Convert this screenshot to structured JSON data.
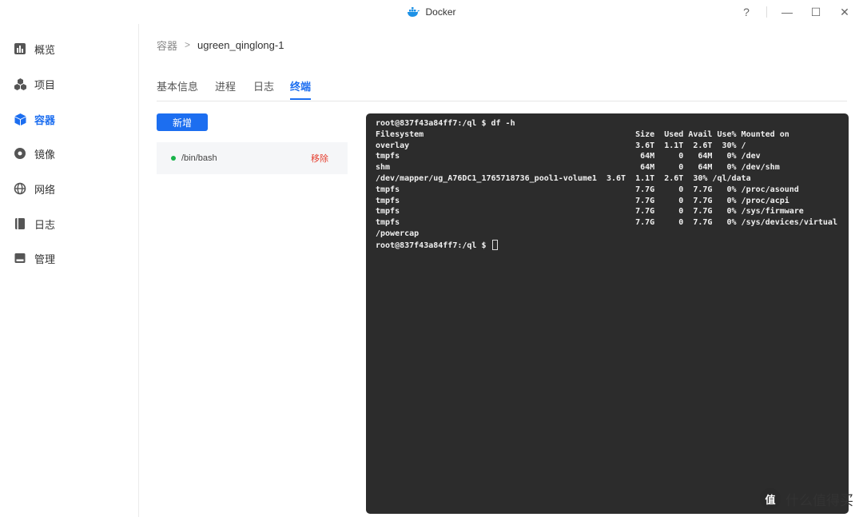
{
  "window": {
    "title": "Docker",
    "help": "?",
    "minimize": "—",
    "maximize": "☐",
    "close": "✕"
  },
  "sidebar": {
    "items": [
      {
        "label": "概览",
        "icon": "chart-icon",
        "active": false
      },
      {
        "label": "项目",
        "icon": "cubes-icon",
        "active": false
      },
      {
        "label": "容器",
        "icon": "cube-icon",
        "active": true
      },
      {
        "label": "镜像",
        "icon": "disc-icon",
        "active": false
      },
      {
        "label": "网络",
        "icon": "globe-icon",
        "active": false
      },
      {
        "label": "日志",
        "icon": "book-icon",
        "active": false
      },
      {
        "label": "管理",
        "icon": "manage-icon",
        "active": false
      }
    ]
  },
  "breadcrumb": {
    "root": "容器",
    "separator": ">",
    "current": "ugreen_qinglong-1"
  },
  "tabs": [
    {
      "label": "基本信息",
      "active": false
    },
    {
      "label": "进程",
      "active": false
    },
    {
      "label": "日志",
      "active": false
    },
    {
      "label": "终端",
      "active": true
    }
  ],
  "terminal_panel": {
    "add_label": "新增",
    "sessions": [
      {
        "name": "/bin/bash",
        "status": "running",
        "remove_label": "移除"
      }
    ]
  },
  "terminal": {
    "lines": [
      "root@837f43a84ff7:/ql $ df -h",
      "Filesystem                                            Size  Used Avail Use% Mounted on",
      "overlay                                               3.6T  1.1T  2.6T  30% /",
      "tmpfs                                                  64M     0   64M   0% /dev",
      "shm                                                    64M     0   64M   0% /dev/shm",
      "/dev/mapper/ug_A76DC1_1765718736_pool1-volume1  3.6T  1.1T  2.6T  30% /ql/data",
      "tmpfs                                                 7.7G     0  7.7G   0% /proc/asound",
      "tmpfs                                                 7.7G     0  7.7G   0% /proc/acpi",
      "tmpfs                                                 7.7G     0  7.7G   0% /sys/firmware",
      "tmpfs                                                 7.7G     0  7.7G   0% /sys/devices/virtual",
      "/powercap"
    ],
    "prompt": "root@837f43a84ff7:/ql $ "
  },
  "watermark": {
    "badge": "值",
    "text": "什么值得买"
  },
  "colors": {
    "accent": "#1c6ef0",
    "running": "#19b34a",
    "danger": "#e53e2e",
    "terminal_bg": "#2c2c2c"
  }
}
